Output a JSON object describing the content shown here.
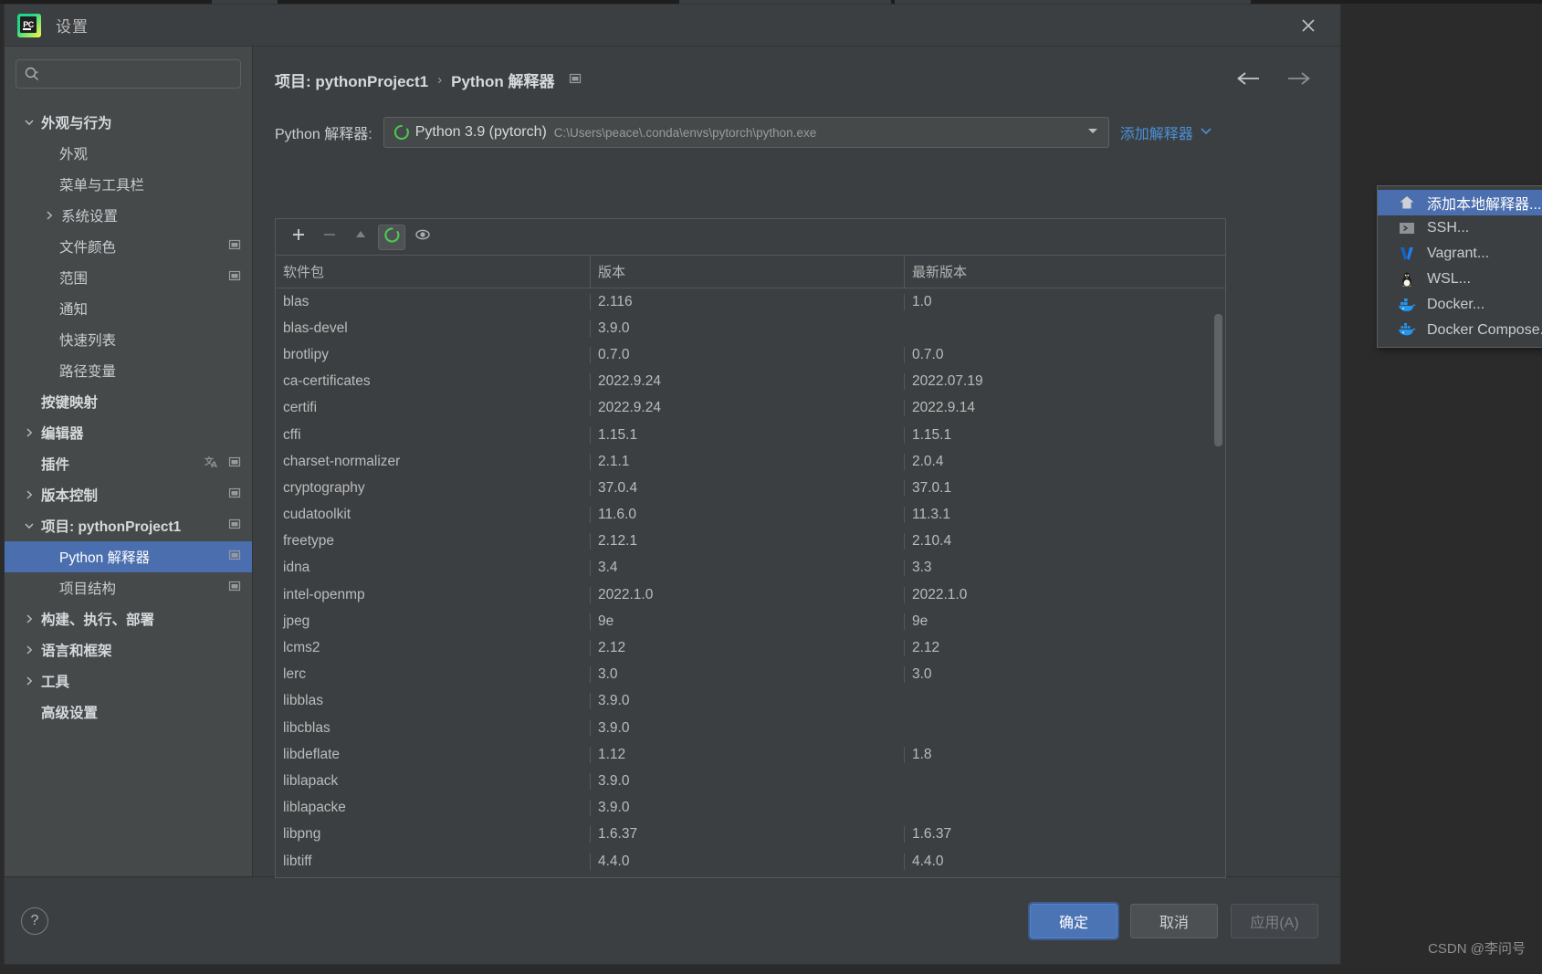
{
  "window": {
    "title": "设置",
    "logo_text": "PC",
    "close_icon": "close-icon"
  },
  "sidebar": {
    "search_placeholder": "",
    "search_value": "",
    "items": [
      {
        "label": "外观与行为",
        "level": 0,
        "chevron": "down",
        "bold": true,
        "selected": false,
        "trail": []
      },
      {
        "label": "外观",
        "level": 1,
        "chevron": "",
        "bold": false,
        "selected": false,
        "trail": []
      },
      {
        "label": "菜单与工具栏",
        "level": 1,
        "chevron": "",
        "bold": false,
        "selected": false,
        "trail": []
      },
      {
        "label": "系统设置",
        "level": 1,
        "chevron": "right",
        "bold": false,
        "selected": false,
        "trail": []
      },
      {
        "label": "文件颜色",
        "level": 1,
        "chevron": "",
        "bold": false,
        "selected": false,
        "trail": [
          "project-scope-icon"
        ]
      },
      {
        "label": "范围",
        "level": 1,
        "chevron": "",
        "bold": false,
        "selected": false,
        "trail": [
          "project-scope-icon"
        ]
      },
      {
        "label": "通知",
        "level": 1,
        "chevron": "",
        "bold": false,
        "selected": false,
        "trail": []
      },
      {
        "label": "快速列表",
        "level": 1,
        "chevron": "",
        "bold": false,
        "selected": false,
        "trail": []
      },
      {
        "label": "路径变量",
        "level": 1,
        "chevron": "",
        "bold": false,
        "selected": false,
        "trail": []
      },
      {
        "label": "按键映射",
        "level": 0,
        "chevron": "",
        "bold": true,
        "selected": false,
        "trail": []
      },
      {
        "label": "编辑器",
        "level": 0,
        "chevron": "right",
        "bold": true,
        "selected": false,
        "trail": []
      },
      {
        "label": "插件",
        "level": 0,
        "chevron": "",
        "bold": true,
        "selected": false,
        "trail": [
          "language-icon",
          "project-scope-icon"
        ]
      },
      {
        "label": "版本控制",
        "level": 0,
        "chevron": "right",
        "bold": true,
        "selected": false,
        "trail": [
          "project-scope-icon"
        ]
      },
      {
        "label": "项目: pythonProject1",
        "level": 0,
        "chevron": "down",
        "bold": true,
        "selected": false,
        "trail": [
          "project-scope-icon"
        ]
      },
      {
        "label": "Python 解释器",
        "level": 1,
        "chevron": "",
        "bold": false,
        "selected": true,
        "trail": [
          "project-scope-icon"
        ]
      },
      {
        "label": "项目结构",
        "level": 1,
        "chevron": "",
        "bold": false,
        "selected": false,
        "trail": [
          "project-scope-icon"
        ]
      },
      {
        "label": "构建、执行、部署",
        "level": 0,
        "chevron": "right",
        "bold": true,
        "selected": false,
        "trail": []
      },
      {
        "label": "语言和框架",
        "level": 0,
        "chevron": "right",
        "bold": true,
        "selected": false,
        "trail": []
      },
      {
        "label": "工具",
        "level": 0,
        "chevron": "right",
        "bold": true,
        "selected": false,
        "trail": []
      },
      {
        "label": "高级设置",
        "level": 0,
        "chevron": "",
        "bold": true,
        "selected": false,
        "trail": []
      }
    ]
  },
  "breadcrumb": {
    "project": "项目: pythonProject1",
    "separator": "›",
    "page": "Python 解释器"
  },
  "nav": {
    "back_icon": "arrow-left-icon",
    "forward_icon": "arrow-right-icon"
  },
  "interpreter": {
    "label": "Python 解释器:",
    "name": "Python 3.9 (pytorch)",
    "path": "C:\\Users\\peace\\.conda\\envs\\pytorch\\python.exe",
    "dropdown_icon": "chevron-down-icon",
    "add_link": "添加解释器",
    "add_link_icon": "chevron-down-icon"
  },
  "add_menu": {
    "items": [
      {
        "label": "添加本地解释器...",
        "icon": "home-icon",
        "highlighted": true
      },
      {
        "label": "SSH...",
        "icon": "terminal-icon",
        "highlighted": false
      },
      {
        "label": "Vagrant...",
        "icon": "vagrant-icon",
        "highlighted": false
      },
      {
        "label": "WSL...",
        "icon": "linux-penguin-icon",
        "highlighted": false
      },
      {
        "label": "Docker...",
        "icon": "docker-icon",
        "highlighted": false
      },
      {
        "label": "Docker Compose...",
        "icon": "docker-compose-icon",
        "highlighted": false
      }
    ]
  },
  "packages": {
    "toolbar": [
      {
        "name": "add-package-button",
        "icon": "plus-icon",
        "active": false
      },
      {
        "name": "remove-package-button",
        "icon": "minus-icon",
        "active": false
      },
      {
        "name": "upgrade-package-button",
        "icon": "triangle-up-icon",
        "active": false
      },
      {
        "name": "refresh-button",
        "icon": "refresh-circle-icon",
        "active": true
      },
      {
        "name": "show-early-releases-button",
        "icon": "eye-icon",
        "active": false
      }
    ],
    "columns": [
      "软件包",
      "版本",
      "最新版本"
    ],
    "rows": [
      {
        "package": "blas",
        "version": "2.116",
        "latest": "1.0"
      },
      {
        "package": "blas-devel",
        "version": "3.9.0",
        "latest": ""
      },
      {
        "package": "brotlipy",
        "version": "0.7.0",
        "latest": "0.7.0"
      },
      {
        "package": "ca-certificates",
        "version": "2022.9.24",
        "latest": "2022.07.19"
      },
      {
        "package": "certifi",
        "version": "2022.9.24",
        "latest": "2022.9.14"
      },
      {
        "package": "cffi",
        "version": "1.15.1",
        "latest": "1.15.1"
      },
      {
        "package": "charset-normalizer",
        "version": "2.1.1",
        "latest": "2.0.4"
      },
      {
        "package": "cryptography",
        "version": "37.0.4",
        "latest": "37.0.1"
      },
      {
        "package": "cudatoolkit",
        "version": "11.6.0",
        "latest": "11.3.1"
      },
      {
        "package": "freetype",
        "version": "2.12.1",
        "latest": "2.10.4"
      },
      {
        "package": "idna",
        "version": "3.4",
        "latest": "3.3"
      },
      {
        "package": "intel-openmp",
        "version": "2022.1.0",
        "latest": "2022.1.0"
      },
      {
        "package": "jpeg",
        "version": "9e",
        "latest": "9e"
      },
      {
        "package": "lcms2",
        "version": "2.12",
        "latest": "2.12"
      },
      {
        "package": "lerc",
        "version": "3.0",
        "latest": "3.0"
      },
      {
        "package": "libblas",
        "version": "3.9.0",
        "latest": ""
      },
      {
        "package": "libcblas",
        "version": "3.9.0",
        "latest": ""
      },
      {
        "package": "libdeflate",
        "version": "1.12",
        "latest": "1.8"
      },
      {
        "package": "liblapack",
        "version": "3.9.0",
        "latest": ""
      },
      {
        "package": "liblapacke",
        "version": "3.9.0",
        "latest": ""
      },
      {
        "package": "libpng",
        "version": "1.6.37",
        "latest": "1.6.37"
      },
      {
        "package": "libtiff",
        "version": "4.4.0",
        "latest": "4.4.0"
      }
    ]
  },
  "footer": {
    "help_label": "?",
    "ok": "确定",
    "cancel": "取消",
    "apply": "应用(A)"
  },
  "watermark": "CSDN @李问号",
  "colors": {
    "accent": "#4b6eaf",
    "primary_button": "#4b74b5",
    "link": "#4a90d9",
    "panel": "#3c3f41",
    "sidebar": "#45494a"
  }
}
